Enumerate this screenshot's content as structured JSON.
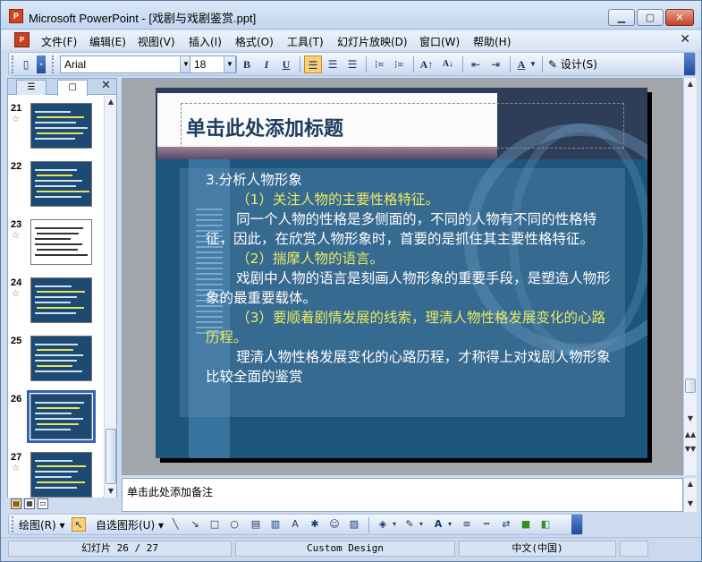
{
  "window": {
    "title": "Microsoft PowerPoint - [戏剧与戏剧鉴赏.ppt]",
    "app_icon_text": "P"
  },
  "menu": {
    "items": [
      "文件(F)",
      "编辑(E)",
      "视图(V)",
      "插入(I)",
      "格式(O)",
      "工具(T)",
      "幻灯片放映(D)",
      "窗口(W)",
      "帮助(H)"
    ]
  },
  "toolbar": {
    "font": "Arial",
    "size": "18",
    "bold": "B",
    "italic": "I",
    "underline": "U",
    "design_label": "设计(S)"
  },
  "thumbnails": [
    {
      "number": "21",
      "starred": true
    },
    {
      "number": "22",
      "starred": false
    },
    {
      "number": "23",
      "starred": true
    },
    {
      "number": "24",
      "starred": true
    },
    {
      "number": "25",
      "starred": false
    },
    {
      "number": "26",
      "starred": false
    },
    {
      "number": "27",
      "starred": true
    }
  ],
  "selected_slide": "26",
  "slide": {
    "title_placeholder": "单击此处添加标题",
    "body": [
      {
        "text": "3.分析人物形象",
        "style": "white"
      },
      {
        "text": "（1）关注人物的主要性格特征。",
        "style": "yellow-indent"
      },
      {
        "text": "同一个人物的性格是多侧面的，不同的人物有不同的性格特征，因此，在欣赏人物形象时，首要的是抓住其主要性格特征。",
        "style": "white-indent"
      },
      {
        "text": "（2）揣摩人物的语言。",
        "style": "yellow-indent"
      },
      {
        "text": "戏剧中人物的语言是刻画人物形象的重要手段，是塑造人物形象的最重要载体。",
        "style": "white-indent"
      },
      {
        "text": "（3）要顺着剧情发展的线索，理清人物性格发展变化的心路历程。",
        "style": "yellow-indent"
      },
      {
        "text": "理清人物性格发展变化的心路历程，才称得上对戏剧人物形象比较全面的鉴赏",
        "style": "white-indent"
      }
    ]
  },
  "notes": {
    "placeholder": "单击此处添加备注"
  },
  "drawing": {
    "draw_label": "绘图(R)",
    "autoshapes_label": "自选图形(U)"
  },
  "status": {
    "slide_info": "幻灯片 26 / 27",
    "design": "Custom Design",
    "language": "中文(中国)"
  },
  "colors": {
    "slide_bg": "#1d557d",
    "highlight_text": "#eaea63",
    "title_color": "#1d3b5e"
  }
}
